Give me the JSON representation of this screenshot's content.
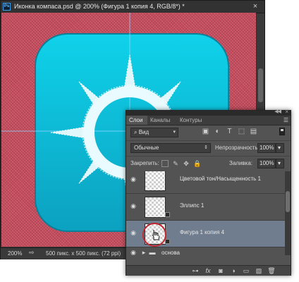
{
  "document": {
    "title": "Иконка компаса.psd @ 200% (Фигура 1 копия 4, RGB/8*) *",
    "app_icon_text": "Ps",
    "close_icon": "×",
    "zoom": "200%",
    "doc_info": "500 пикс. x 500 пикс. (72 ppi)"
  },
  "colors": {
    "canvas_bg": "#c54b5c",
    "icon_fill": "#13b4cf",
    "selected_layer": "#6f7d8f",
    "cursor_ring": "#c0262e"
  },
  "layers_panel": {
    "tabs": [
      {
        "label": "Слои",
        "active": true
      },
      {
        "label": "Каналы",
        "active": false
      },
      {
        "label": "Контуры",
        "active": false
      }
    ],
    "filter_kind": "Вид",
    "blend_mode": "Обычные",
    "opacity_label": "Непрозрачность:",
    "opacity_value": "100%",
    "lock_label": "Закрепить:",
    "fill_label": "Заливка:",
    "fill_value": "100%",
    "layers": [
      {
        "name": "Цветовой тон/Насыщенность 1",
        "visible": true,
        "selected": false
      },
      {
        "name": "Эллипс 1",
        "visible": true,
        "selected": false
      },
      {
        "name": "Фигура 1 копия 4",
        "visible": true,
        "selected": true
      },
      {
        "name": "основа",
        "visible": true,
        "selected": false,
        "type": "group"
      }
    ],
    "bottom_icons": [
      "link-icon",
      "fx-icon",
      "mask-icon",
      "adjustment-icon",
      "folder-icon",
      "new-layer-icon",
      "trash-icon"
    ],
    "fx_label": "fx"
  }
}
